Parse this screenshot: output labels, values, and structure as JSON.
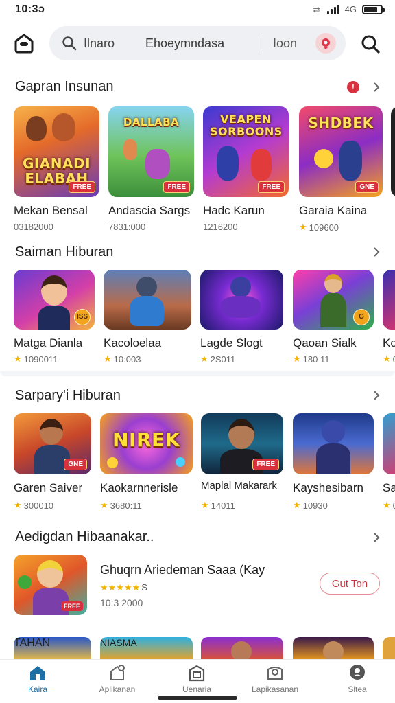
{
  "status_bar": {
    "time": "10:3ↄ",
    "network": "4G",
    "battery_level": 0.8
  },
  "search": {
    "query": "Ilnaro",
    "placeholder": "Ehoeymndasa",
    "tag": "Ioon"
  },
  "sections": [
    {
      "title": "Gapran Insunan",
      "has_badge": true,
      "badge": "!",
      "items": [
        {
          "name": "Mekan Bensal",
          "meta": "03182000",
          "star": false,
          "art": "GIANADI ELABAH",
          "tag": "FREE"
        },
        {
          "name": "Andascia Sargs",
          "meta": "7831:000",
          "star": false,
          "art": "DALLABA",
          "tag": "FREE"
        },
        {
          "name": "Hadc Karun",
          "meta": "1216200",
          "star": false,
          "art": "VEAPEN SORBOONS",
          "tag": "FREE"
        },
        {
          "name": "Garaia Kaina",
          "meta": "109600",
          "star": true,
          "art": "SHDBEK",
          "tag": "GNE"
        }
      ]
    },
    {
      "title": "Saiman Hiburan",
      "items": [
        {
          "name": "Matga Dianla",
          "meta": "1090011",
          "star": true,
          "tag": "ISS"
        },
        {
          "name": "Kacoloelaa",
          "meta": "10:003",
          "star": true
        },
        {
          "name": "Lagde Slogt",
          "meta": "2S011",
          "star": true
        },
        {
          "name": "Qaoan Sialk",
          "meta": "180 11",
          "star": true,
          "tag": "G"
        },
        {
          "name": "Ko",
          "meta": "0",
          "star": true
        }
      ]
    },
    {
      "title": "Sarpary'i Hiburan",
      "items": [
        {
          "name": "Garen Saiver",
          "meta": "300010",
          "star": true,
          "tag": "GNE"
        },
        {
          "name": "Kaokarnnerisle",
          "meta": "3680:11",
          "star": true,
          "art": "NIREK"
        },
        {
          "name": "Maplal Makarark",
          "meta": "14011",
          "star": true,
          "tag": "FREE"
        },
        {
          "name": "Kayshesibarn",
          "meta": "10930",
          "star": true
        },
        {
          "name": "Sa",
          "meta": "0",
          "star": true
        }
      ]
    },
    {
      "title": "Aedigdan Hibaanakar..",
      "featured": {
        "title": "Ghuqrn Ariedeman Saaa (Kay",
        "stars": "★★★★★",
        "rating": "S",
        "meta": "10:3 2000",
        "button": "Gut Ton",
        "tag": "FREE"
      },
      "partial_items": [
        {
          "art": "TAHAN"
        },
        {
          "art": "NIASMA"
        },
        {
          "art": ""
        },
        {
          "art": ""
        }
      ]
    }
  ],
  "bottom_nav": [
    {
      "label": "Kaira",
      "icon": "home-icon",
      "active": true
    },
    {
      "label": "Aplikanan",
      "icon": "apps-icon",
      "active": false
    },
    {
      "label": "Uenaria",
      "icon": "games-icon",
      "active": false
    },
    {
      "label": "Lapikasanan",
      "icon": "library-icon",
      "active": false
    },
    {
      "label": "Sltea",
      "icon": "profile-icon",
      "active": false
    }
  ],
  "colors": {
    "accent": "#1d6fa5",
    "badge": "#d7323f",
    "star": "#f2b300",
    "button_border": "#e58b92"
  }
}
